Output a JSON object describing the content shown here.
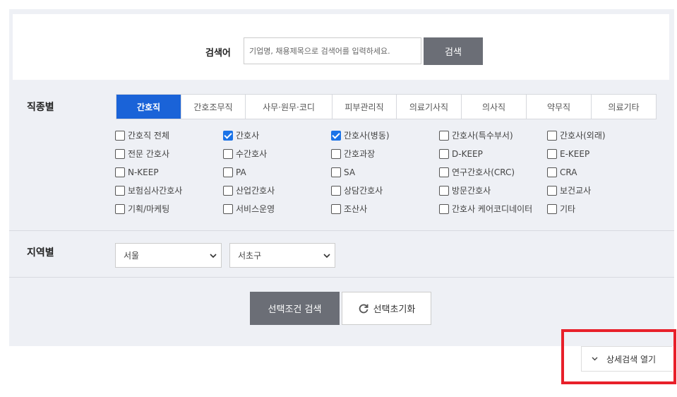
{
  "search": {
    "label": "검색어",
    "placeholder": "기업명, 채용제목으로 검색어를 입력하세요.",
    "button": "검색"
  },
  "job_category": {
    "title": "직종별",
    "tabs": [
      {
        "label": "간호직",
        "active": true
      },
      {
        "label": "간호조무직",
        "active": false
      },
      {
        "label": "사무·원무·코디",
        "active": false
      },
      {
        "label": "피부관리직",
        "active": false
      },
      {
        "label": "의료기사직",
        "active": false
      },
      {
        "label": "의사직",
        "active": false
      },
      {
        "label": "약무직",
        "active": false
      },
      {
        "label": "의료기타",
        "active": false
      }
    ],
    "options": [
      {
        "label": "간호직 전체",
        "checked": false
      },
      {
        "label": "간호사",
        "checked": true
      },
      {
        "label": "간호사(병동)",
        "checked": true
      },
      {
        "label": "간호사(특수부서)",
        "checked": false
      },
      {
        "label": "간호사(외래)",
        "checked": false
      },
      {
        "label": "전문 간호사",
        "checked": false
      },
      {
        "label": "수간호사",
        "checked": false
      },
      {
        "label": "간호과장",
        "checked": false
      },
      {
        "label": "D-KEEP",
        "checked": false
      },
      {
        "label": "E-KEEP",
        "checked": false
      },
      {
        "label": "N-KEEP",
        "checked": false
      },
      {
        "label": "PA",
        "checked": false
      },
      {
        "label": "SA",
        "checked": false
      },
      {
        "label": "연구간호사(CRC)",
        "checked": false
      },
      {
        "label": "CRA",
        "checked": false
      },
      {
        "label": "보험심사간호사",
        "checked": false
      },
      {
        "label": "산업간호사",
        "checked": false
      },
      {
        "label": "상담간호사",
        "checked": false
      },
      {
        "label": "방문간호사",
        "checked": false
      },
      {
        "label": "보건교사",
        "checked": false
      },
      {
        "label": "기획/마케팅",
        "checked": false
      },
      {
        "label": "서비스운영",
        "checked": false
      },
      {
        "label": "조산사",
        "checked": false
      },
      {
        "label": "간호사 케어코디네이터",
        "checked": false
      },
      {
        "label": "기타",
        "checked": false
      }
    ]
  },
  "region": {
    "title": "지역별",
    "city": "서울",
    "district": "서초구"
  },
  "actions": {
    "search_selected": "선택조건 검색",
    "reset": "선택초기화"
  },
  "detail_toggle": {
    "label": "상세검색 열기"
  },
  "colors": {
    "accent": "#1a63d8",
    "panel_bg": "#eef0f5",
    "dark_button": "#6b6e76",
    "highlight": "#e8202a"
  }
}
